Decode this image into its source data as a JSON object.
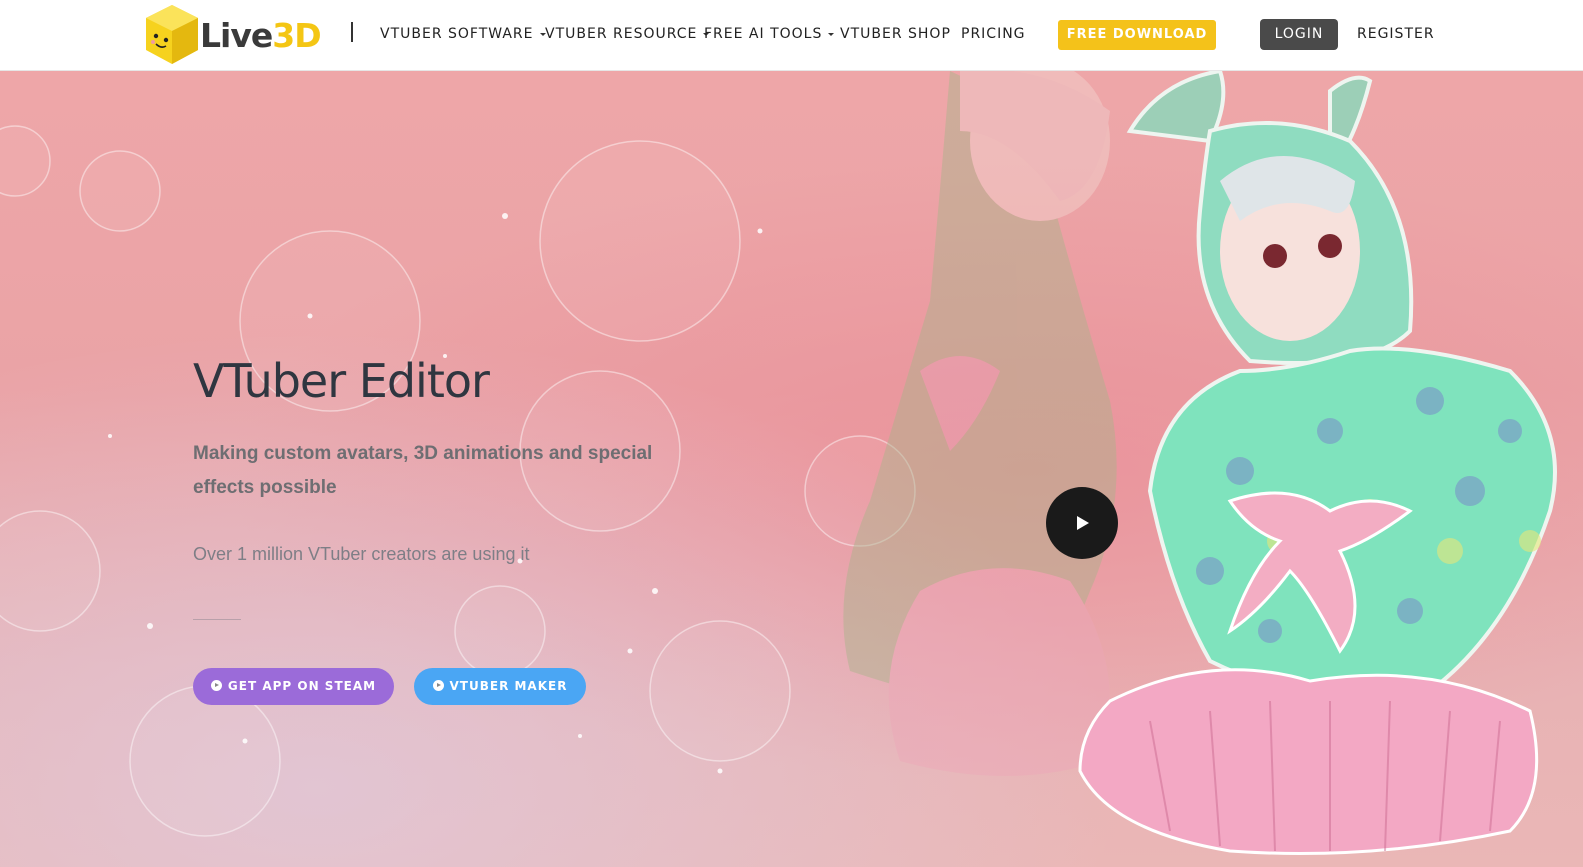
{
  "brand": {
    "name_prefix": "Live",
    "name_highlight": "3D"
  },
  "nav": {
    "separator": "|",
    "items": [
      {
        "label": "VTUBER SOFTWARE",
        "has_dropdown": true
      },
      {
        "label": "VTUBER RESOURCE",
        "has_dropdown": true
      },
      {
        "label": "FREE AI TOOLS",
        "has_dropdown": true
      },
      {
        "label": "VTUBER SHOP",
        "has_dropdown": false
      },
      {
        "label": "PRICING",
        "has_dropdown": false
      }
    ],
    "download_label": "FREE DOWNLOAD",
    "login_label": "LOGIN",
    "register_label": "REGISTER"
  },
  "hero": {
    "title": "VTuber Editor",
    "subtitle": "Making custom avatars, 3D animations and special effects possible",
    "users_text": "Over 1 million VTuber creators are using it",
    "steam_button": "GET APP ON STEAM",
    "maker_button": "VTUBER MAKER"
  },
  "colors": {
    "accent_yellow": "#f4c21a",
    "login_bg": "#4a4a4a",
    "steam_purple": "#9b6bd9",
    "maker_blue": "#4aa6f4",
    "hero_pink": "#eea6a8",
    "title_dark": "#2f3640"
  },
  "icons": [
    "logo-cube-icon",
    "caret-down-icon",
    "play-icon",
    "arrow-circle-icon"
  ]
}
